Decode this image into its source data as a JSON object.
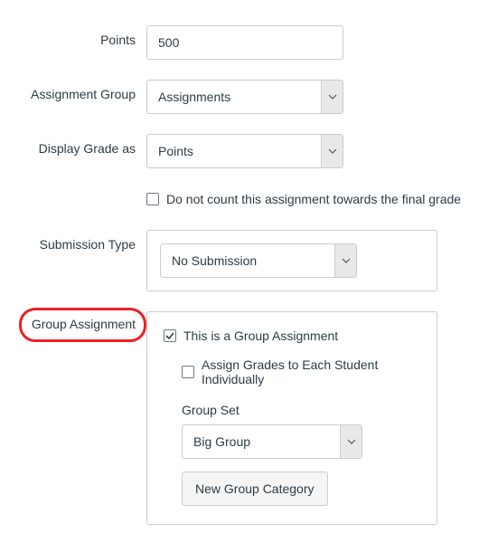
{
  "labels": {
    "points": "Points",
    "assignment_group": "Assignment Group",
    "display_grade_as": "Display Grade as",
    "submission_type": "Submission Type",
    "group_assignment": "Group Assignment",
    "group_set": "Group Set"
  },
  "values": {
    "points": "500",
    "assignment_group": "Assignments",
    "display_grade_as": "Points",
    "submission_type": "No Submission",
    "group_set": "Big Group"
  },
  "checkboxes": {
    "omit_from_final": {
      "checked": false,
      "label": "Do not count this assignment towards the final grade"
    },
    "is_group": {
      "checked": true,
      "label": "This is a Group Assignment"
    },
    "grade_individually": {
      "checked": false,
      "label": "Assign Grades to Each Student Individually"
    }
  },
  "buttons": {
    "new_group_category": "New Group Category"
  },
  "colors": {
    "highlight": "#ed2024"
  }
}
